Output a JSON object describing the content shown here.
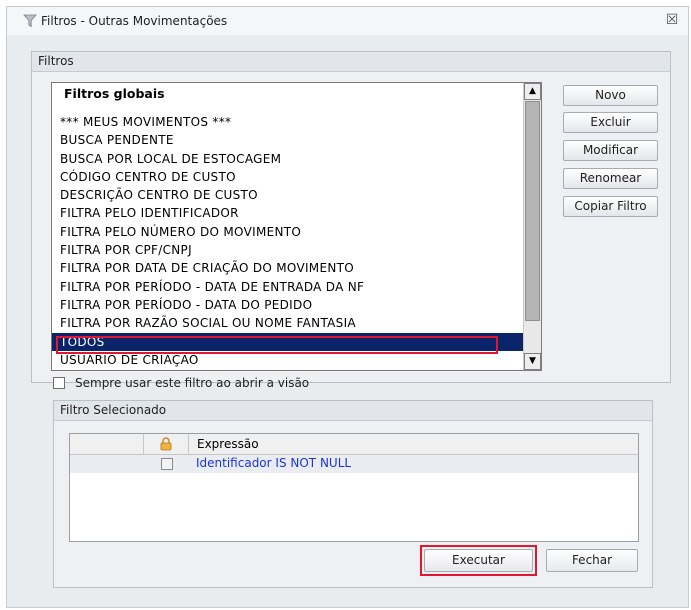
{
  "window": {
    "title": "Filtros - Outras Movimentações",
    "close_glyph": "☒",
    "icon": "filter-icon"
  },
  "filters_group": {
    "title": "Filtros",
    "list_header": "Filtros globais",
    "items": [
      "*** MEUS MOVIMENTOS ***",
      "BUSCA PENDENTE",
      "BUSCA POR LOCAL DE ESTOCAGEM",
      "CÓDIGO CENTRO DE CUSTO",
      "DESCRIÇÃO CENTRO DE CUSTO",
      "FILTRA PELO IDENTIFICADOR",
      "FILTRA PELO NÚMERO DO MOVIMENTO",
      "FILTRA POR CPF/CNPJ",
      "FILTRA POR DATA DE CRIAÇÃO DO MOVIMENTO",
      "FILTRA POR PERÍODO - DATA DE ENTRADA DA NF",
      "FILTRA POR PERÍODO - DATA DO PEDIDO",
      "FILTRA POR RAZÃO SOCIAL OU NOME FANTASIA",
      "TODOS",
      "USUARIO DE CRIAÇÃO"
    ],
    "selected_item": "TODOS",
    "buttons": {
      "novo": "Novo",
      "excluir": "Excluir",
      "modificar": "Modificar",
      "renomear": "Renomear",
      "copiar": "Copiar Filtro"
    },
    "always_use_label": "Sempre usar este filtro ao abrir a visão",
    "always_use_checked": false
  },
  "selected_filter": {
    "title": "Filtro Selecionado",
    "columns": [
      "",
      "lock-icon",
      "Expressão"
    ],
    "rows": [
      {
        "checked": false,
        "expression": "Identificador IS NOT NULL"
      }
    ]
  },
  "footer": {
    "executar": "Executar",
    "fechar": "Fechar"
  },
  "colors": {
    "selection": "#0a246a",
    "highlight_outline": "#e0182d",
    "expression_text": "#1b34d8"
  }
}
